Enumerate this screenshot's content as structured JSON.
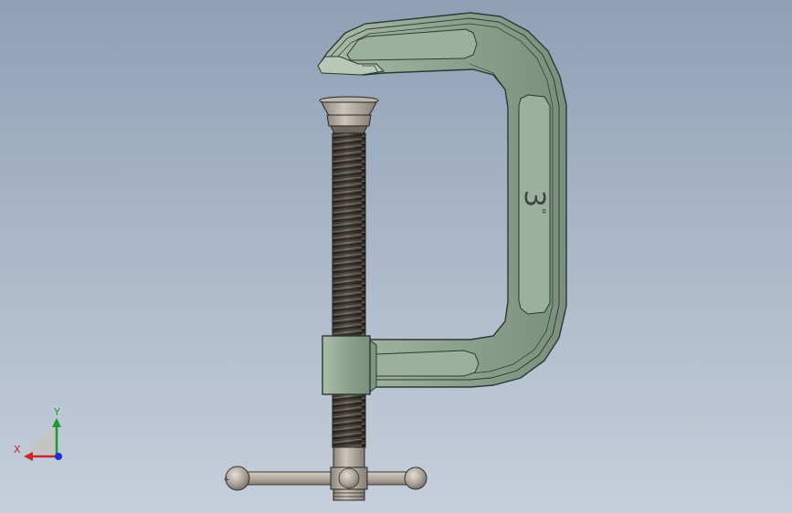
{
  "model": {
    "engraving_size": "3",
    "engraving_unit": "\""
  },
  "triad": {
    "x_label": "X",
    "y_label": "Y",
    "x_color": "#c8282a",
    "y_color": "#1f9a2e",
    "z_color": "#1a2fd6"
  },
  "colors": {
    "frame_fill": "#8fa593",
    "frame_edge": "#2b3a30",
    "screw_dark": "#2f2c28",
    "screw_light": "#7d766c",
    "handle_fill": "#b8afa7",
    "pad_fill": "#9a938a"
  },
  "icons": {
    "triad": "view-orientation-triad-icon"
  }
}
